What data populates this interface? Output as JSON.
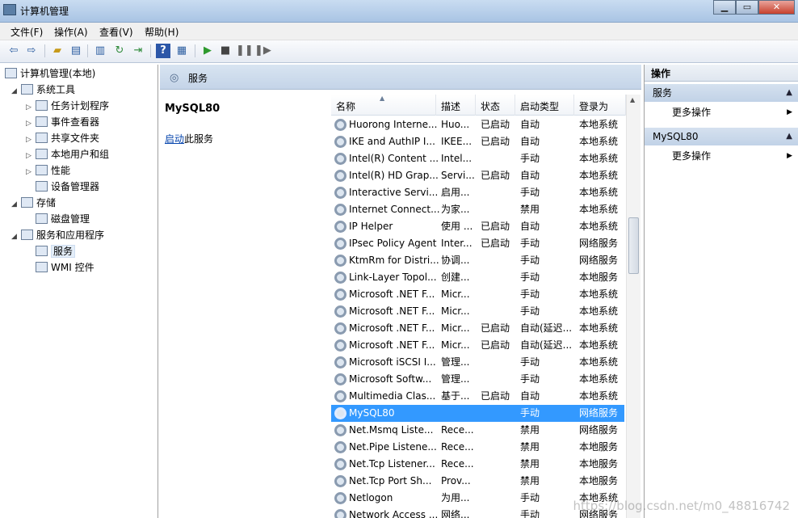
{
  "window": {
    "title": "计算机管理"
  },
  "menu": [
    "文件(F)",
    "操作(A)",
    "查看(V)",
    "帮助(H)"
  ],
  "tree": [
    {
      "label": "计算机管理(本地)",
      "level": 0,
      "expander": ""
    },
    {
      "label": "系统工具",
      "level": 1,
      "expander": "◢"
    },
    {
      "label": "任务计划程序",
      "level": 2,
      "expander": "▷"
    },
    {
      "label": "事件查看器",
      "level": 2,
      "expander": "▷"
    },
    {
      "label": "共享文件夹",
      "level": 2,
      "expander": "▷"
    },
    {
      "label": "本地用户和组",
      "level": 2,
      "expander": "▷"
    },
    {
      "label": "性能",
      "level": 2,
      "expander": "▷"
    },
    {
      "label": "设备管理器",
      "level": 2,
      "expander": ""
    },
    {
      "label": "存储",
      "level": 1,
      "expander": "◢"
    },
    {
      "label": "磁盘管理",
      "level": 2,
      "expander": ""
    },
    {
      "label": "服务和应用程序",
      "level": 1,
      "expander": "◢"
    },
    {
      "label": "服务",
      "level": 2,
      "expander": "",
      "selected": true
    },
    {
      "label": "WMI 控件",
      "level": 2,
      "expander": ""
    }
  ],
  "center": {
    "header": "服务",
    "selected_service": "MySQL80",
    "start_link": "启动",
    "start_suffix": "此服务"
  },
  "columns": [
    "名称",
    "描述",
    "状态",
    "启动类型",
    "登录为"
  ],
  "services": [
    [
      "Huorong Interne...",
      "Huo...",
      "已启动",
      "自动",
      "本地系统"
    ],
    [
      "IKE and AuthIP I...",
      "IKEE...",
      "已启动",
      "自动",
      "本地系统"
    ],
    [
      "Intel(R) Content ...",
      "Intel...",
      "",
      "手动",
      "本地系统"
    ],
    [
      "Intel(R) HD Grap...",
      "Servi...",
      "已启动",
      "自动",
      "本地系统"
    ],
    [
      "Interactive Servi...",
      "启用...",
      "",
      "手动",
      "本地系统"
    ],
    [
      "Internet Connect...",
      "为家...",
      "",
      "禁用",
      "本地系统"
    ],
    [
      "IP Helper",
      "使用 ...",
      "已启动",
      "自动",
      "本地系统"
    ],
    [
      "IPsec Policy Agent",
      "Inter...",
      "已启动",
      "手动",
      "网络服务"
    ],
    [
      "KtmRm for Distri...",
      "协调...",
      "",
      "手动",
      "网络服务"
    ],
    [
      "Link-Layer Topol...",
      "创建...",
      "",
      "手动",
      "本地服务"
    ],
    [
      "Microsoft .NET F...",
      "Micr...",
      "",
      "手动",
      "本地系统"
    ],
    [
      "Microsoft .NET F...",
      "Micr...",
      "",
      "手动",
      "本地系统"
    ],
    [
      "Microsoft .NET F...",
      "Micr...",
      "已启动",
      "自动(延迟...",
      "本地系统"
    ],
    [
      "Microsoft .NET F...",
      "Micr...",
      "已启动",
      "自动(延迟...",
      "本地系统"
    ],
    [
      "Microsoft iSCSI I...",
      "管理...",
      "",
      "手动",
      "本地系统"
    ],
    [
      "Microsoft Softw...",
      "管理...",
      "",
      "手动",
      "本地系统"
    ],
    [
      "Multimedia Clas...",
      "基于...",
      "已启动",
      "自动",
      "本地系统"
    ],
    [
      "MySQL80",
      "",
      "",
      "手动",
      "网络服务"
    ],
    [
      "Net.Msmq Liste...",
      "Rece...",
      "",
      "禁用",
      "网络服务"
    ],
    [
      "Net.Pipe Listene...",
      "Rece...",
      "",
      "禁用",
      "本地服务"
    ],
    [
      "Net.Tcp Listener...",
      "Rece...",
      "",
      "禁用",
      "本地服务"
    ],
    [
      "Net.Tcp Port Sh...",
      "Prov...",
      "",
      "禁用",
      "本地服务"
    ],
    [
      "Netlogon",
      "为用...",
      "",
      "手动",
      "本地系统"
    ],
    [
      "Network Access ...",
      "网络...",
      "",
      "手动",
      "网络服务"
    ]
  ],
  "selected_row": 17,
  "actions": {
    "header": "操作",
    "groups": [
      {
        "title": "服务",
        "item": "更多操作"
      },
      {
        "title": "MySQL80",
        "item": "更多操作"
      }
    ]
  },
  "watermark": "https://blog.csdn.net/m0_48816742"
}
